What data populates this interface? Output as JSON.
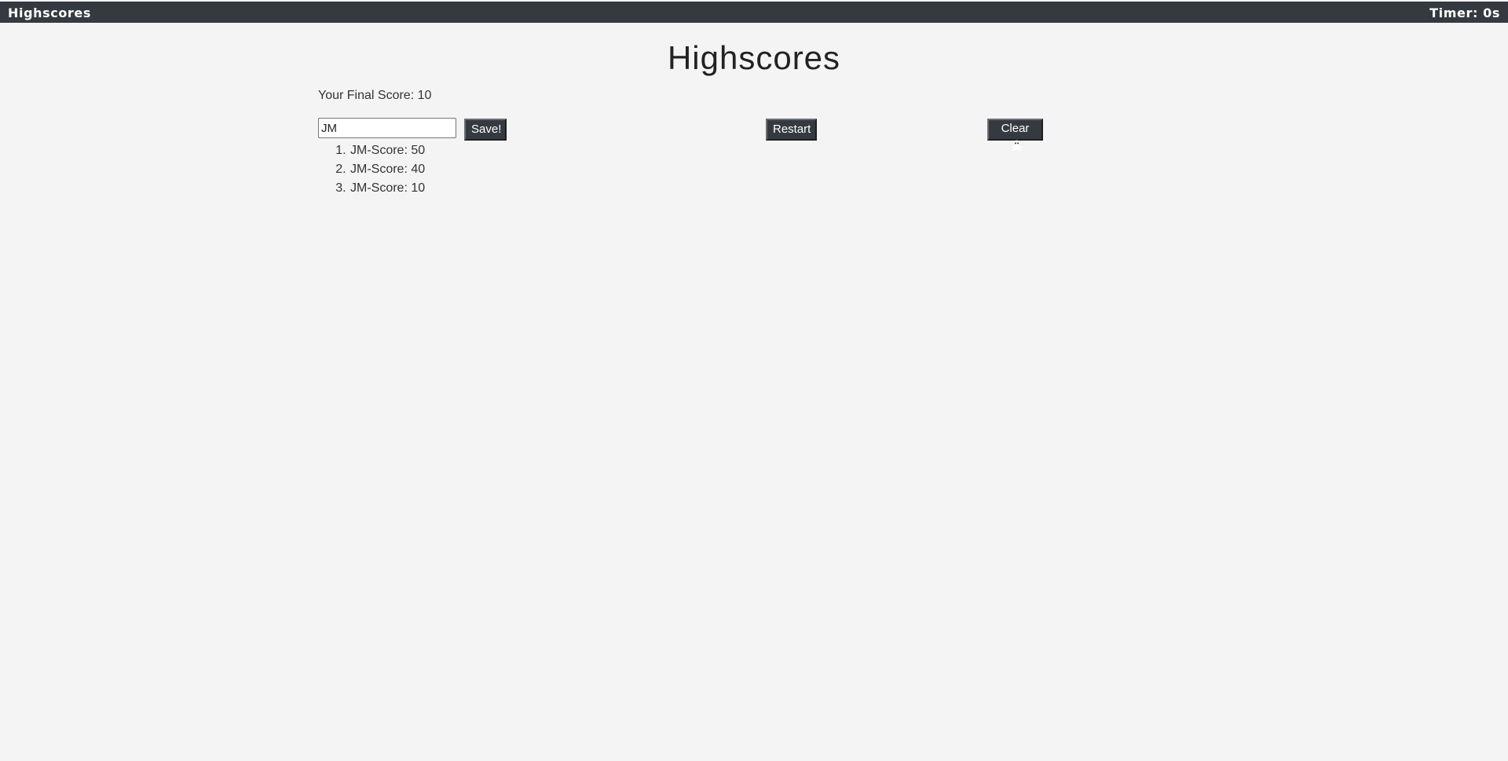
{
  "navbar": {
    "brand": "Highscores",
    "timer": "Timer: 0s"
  },
  "page": {
    "title": "Highscores",
    "final_score_text": "Your Final Score: 10"
  },
  "form": {
    "name_value": "JM",
    "save_label": "Save!"
  },
  "actions": {
    "restart_label": "Restart",
    "clear_label": "Clear",
    "clear_icon": "skull-crossbones-icon"
  },
  "scores": [
    "JM-Score: 50",
    "JM-Score: 40",
    "JM-Score: 10"
  ]
}
